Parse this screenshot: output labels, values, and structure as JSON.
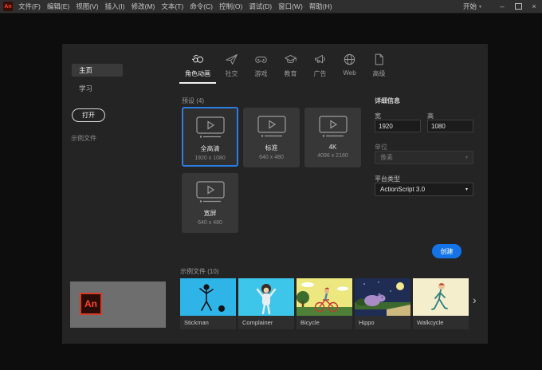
{
  "titlebar": {
    "app_icon": "An",
    "menus": [
      "文件(F)",
      "编辑(E)",
      "视图(V)",
      "插入(I)",
      "修改(M)",
      "文本(T)",
      "命令(C)",
      "控制(O)",
      "调试(D)",
      "窗口(W)",
      "帮助(H)"
    ],
    "workspace": "开始",
    "caret_icon": "▾",
    "minimize_icon": "–",
    "close_icon": "×"
  },
  "sidebar": {
    "home": "主页",
    "learn": "学习",
    "open_button": "打开",
    "samples_link": "示例文件",
    "banner_logo": "An"
  },
  "tabs": {
    "items": [
      {
        "label": "角色动画",
        "icon": "character-animation-icon",
        "selected": true
      },
      {
        "label": "社交",
        "icon": "paper-plane-icon",
        "selected": false
      },
      {
        "label": "游戏",
        "icon": "game-controller-icon",
        "selected": false
      },
      {
        "label": "教育",
        "icon": "graduation-cap-icon",
        "selected": false
      },
      {
        "label": "广告",
        "icon": "megaphone-icon",
        "selected": false
      },
      {
        "label": "Web",
        "icon": "globe-icon",
        "selected": false
      },
      {
        "label": "高级",
        "icon": "document-icon",
        "selected": false
      }
    ]
  },
  "presets": {
    "header": "预设 (4)",
    "cards": [
      {
        "name": "全高清",
        "size": "1920 x 1080",
        "selected": true
      },
      {
        "name": "标准",
        "size": "640 x 480",
        "selected": false
      },
      {
        "name": "4K",
        "size": "4096 x 2160",
        "selected": false
      },
      {
        "name": "宽屏",
        "size": "640 x 480",
        "selected": false
      }
    ]
  },
  "details": {
    "title": "详细信息",
    "width_label": "宽",
    "width_value": "1920",
    "height_label": "高",
    "height_value": "1080",
    "units_label": "单位",
    "units_value": "像素",
    "platform_label": "平台类型",
    "platform_value": "ActionScript 3.0",
    "create_button": "创建",
    "caret_icon": "▾"
  },
  "samples": {
    "header": "示例文件 (10)",
    "items": [
      {
        "name": "Stickman"
      },
      {
        "name": "Complainer"
      },
      {
        "name": "Bicycle"
      },
      {
        "name": "Hippo"
      },
      {
        "name": "Walkcycle"
      }
    ],
    "next_icon": "›"
  },
  "colors": {
    "accent_blue": "#1473e6",
    "selected_border": "#2a7de1",
    "logo_red": "#ff4226",
    "titlebar_bg": "#2f2f2f",
    "window_bg": "#0d0d0d",
    "panel_bg": "#242424",
    "banner_bg": "#6e6e6e",
    "stickman_bg": "#2fb4e8",
    "complainer_bg": "#3ec6ea",
    "bicycle_sky": "#ece77f",
    "hippo_sky": "#1f2d55",
    "walkcycle_bg": "#f4eecd"
  }
}
